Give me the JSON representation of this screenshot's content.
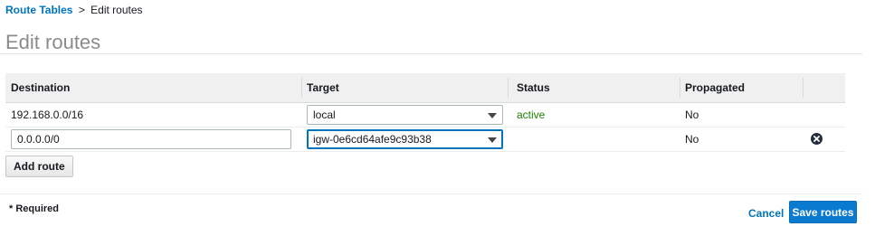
{
  "breadcrumb": {
    "parent_label": "Route Tables",
    "separator": ">",
    "current_label": "Edit routes"
  },
  "page": {
    "title": "Edit routes"
  },
  "table": {
    "columns": [
      "Destination",
      "Target",
      "Status",
      "Propagated"
    ],
    "rows": [
      {
        "destination": "192.168.0.0/16",
        "target": "local",
        "status": "active",
        "propagated": "No",
        "removable": false
      },
      {
        "destination": "0.0.0.0/0",
        "target": "igw-0e6cd64afe9c93b38",
        "status": "",
        "propagated": "No",
        "removable": true
      }
    ]
  },
  "actions": {
    "add_route_label": "Add route",
    "required_note": "* Required",
    "cancel_label": "Cancel",
    "save_label": "Save routes"
  },
  "colors": {
    "link": "#0073bb",
    "status_active": "#1d8102",
    "primary_button": "#0a7ad1",
    "header_bg": "#f0f0f0"
  },
  "icons": {
    "remove_row": "close-circle-icon",
    "dropdown": "caret-down-icon"
  }
}
